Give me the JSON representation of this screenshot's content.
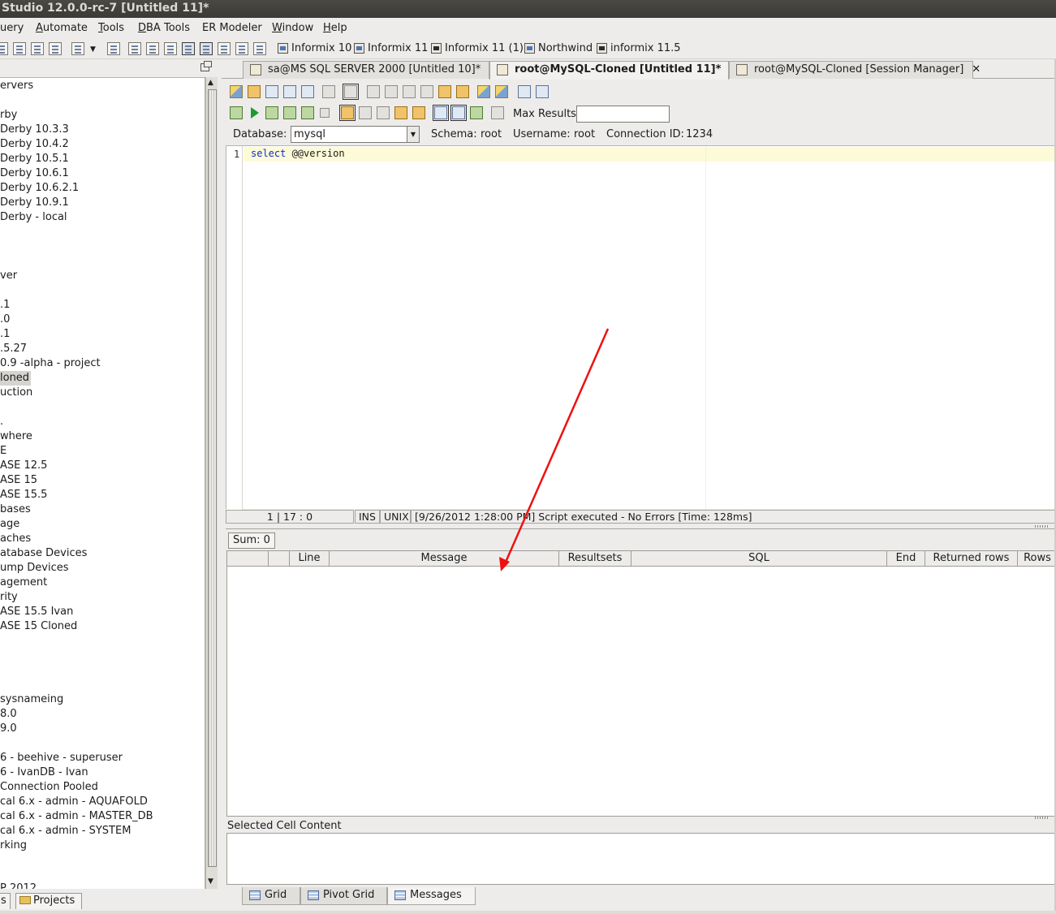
{
  "window": {
    "title": "Studio 12.0.0-rc-7 [Untitled 11]*"
  },
  "menu": {
    "items": [
      {
        "prefix": "",
        "mn": "",
        "rest": "uery"
      },
      {
        "prefix": "",
        "mn": "A",
        "rest": "utomate"
      },
      {
        "prefix": "",
        "mn": "T",
        "rest": "ools"
      },
      {
        "prefix": "",
        "mn": "D",
        "rest": "BA Tools"
      },
      {
        "prefix": "",
        "mn": "",
        "rest": "ER Modeler"
      },
      {
        "prefix": "",
        "mn": "W",
        "rest": "indow"
      },
      {
        "prefix": "",
        "mn": "H",
        "rest": "elp"
      }
    ]
  },
  "toolbar": {
    "connections": [
      "Informix 10",
      "Informix 11",
      "Informix 11 (1)",
      "Northwind",
      "informix 11.5"
    ]
  },
  "tree": {
    "nodes": [
      "ervers",
      "rby",
      "Derby 10.3.3",
      "Derby 10.4.2",
      "Derby 10.5.1",
      "Derby 10.6.1",
      "Derby 10.6.2.1",
      "Derby 10.9.1",
      "Derby - local",
      "ver",
      ".1",
      ".0",
      ".1",
      ".5.27",
      "0.9 -alpha - project",
      "loned",
      "uction",
      ".",
      "where",
      "E",
      "ASE 12.5",
      "ASE 15",
      "ASE 15.5",
      "bases",
      "age",
      "aches",
      "atabase Devices",
      "ump Devices",
      "agement",
      "rity",
      "ASE 15.5 Ivan",
      "ASE 15 Cloned",
      "sysnameing",
      "8.0",
      "9.0",
      "6 - beehive - superuser",
      "6 - IvanDB - Ivan",
      "Connection Pooled",
      "cal 6.x - admin - AQUAFOLD",
      "cal 6.x - admin - MASTER_DB",
      "cal 6.x - admin - SYSTEM",
      "rking",
      "P 2012"
    ],
    "selected": "loned"
  },
  "left_tabs": {
    "first": "s",
    "projects": "Projects"
  },
  "editor_tabs": [
    {
      "label": "sa@MS SQL SERVER 2000 [Untitled 10]*",
      "close": "✕"
    },
    {
      "label": "root@MySQL-Cloned [Untitled 11]*",
      "close": "✕"
    },
    {
      "label": "root@MySQL-Cloned [Session Manager]",
      "close": "✕"
    }
  ],
  "sql_toolbar": {
    "max_results_label": "Max Results:",
    "max_results_value": ""
  },
  "connection": {
    "database_label": "Database:",
    "database_value": "mysql",
    "schema_label": "Schema:",
    "schema_value": "root",
    "username_label": "Username:",
    "username_value": "root",
    "connection_id_label": "Connection ID:",
    "connection_id_value": "1234"
  },
  "editor": {
    "line_number": "1",
    "keyword": "select",
    "rest": " @@version"
  },
  "status": {
    "position": "1 | 17 : 0",
    "mode": "INS",
    "eol": "UNIX",
    "message": "[9/26/2012 1:28:00 PM] Script executed - No Errors [Time: 128ms]"
  },
  "results": {
    "sum_label": "Sum: 0",
    "columns": [
      "",
      "",
      "Line",
      "Message",
      "Resultsets",
      "SQL",
      "End",
      "Returned rows",
      "Rows"
    ]
  },
  "selected_cell": {
    "label": "Selected Cell Content"
  },
  "result_tabs": [
    "Grid",
    "Pivot Grid",
    "Messages"
  ],
  "colors": {
    "annotation_arrow": "#ee1111",
    "keyword": "#0b2bd6",
    "current_line": "#fdfad8"
  }
}
